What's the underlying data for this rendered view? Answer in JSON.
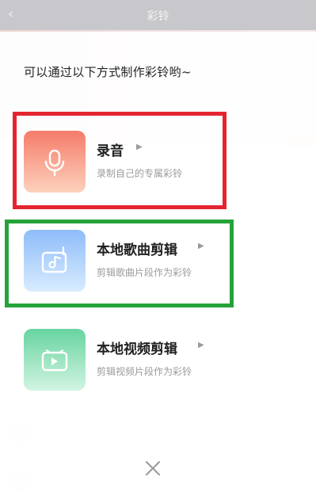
{
  "background": {
    "header_title": "彩铃"
  },
  "sheet": {
    "title": "可以通过以下方式制作彩铃哟~",
    "options": [
      {
        "title": "录音",
        "subtitle": "录制自己的专属彩铃",
        "icon": "microphone-icon",
        "color": "#f67b6a"
      },
      {
        "title": "本地歌曲剪辑",
        "subtitle": "剪辑歌曲片段作为彩铃",
        "icon": "music-clip-icon",
        "color": "#8ebcf9"
      },
      {
        "title": "本地视频剪辑",
        "subtitle": "剪辑视频片段作为彩铃",
        "icon": "video-clip-icon",
        "color": "#67d4a0"
      }
    ],
    "arrow_glyph": "▶",
    "close_icon": "close-icon"
  },
  "highlights": {
    "red": "#e42530",
    "green": "#25a33a"
  }
}
